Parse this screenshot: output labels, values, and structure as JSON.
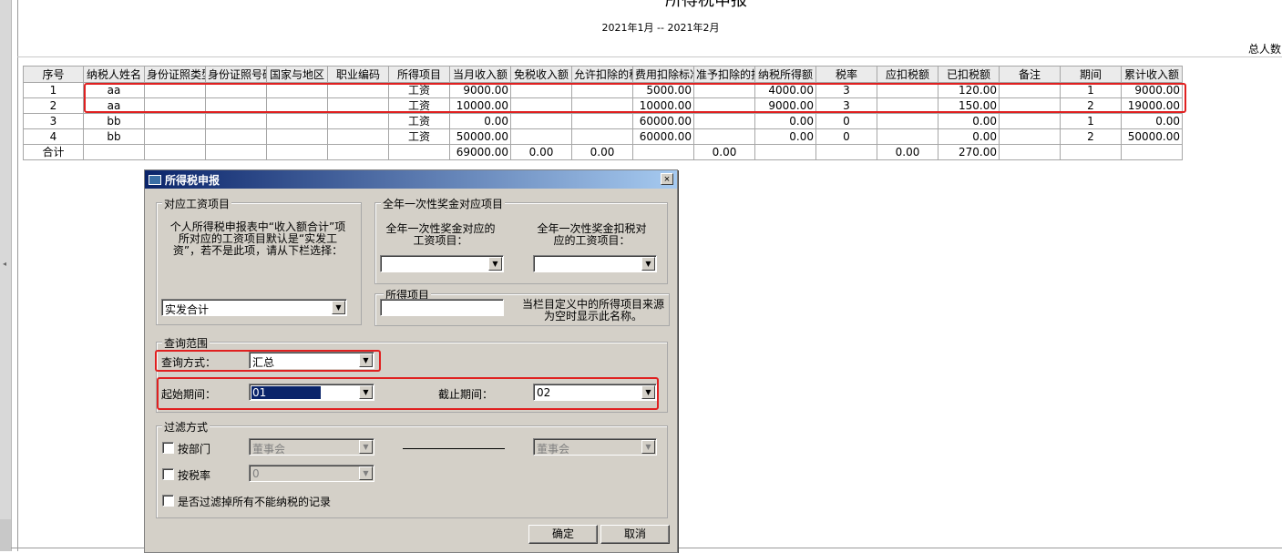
{
  "report": {
    "title": "所得税申报",
    "period": "2021年1月 -- 2021年2月",
    "total_people_label": "总人数"
  },
  "table": {
    "headers": [
      "序号",
      "纳税人姓名",
      "身份证照类型",
      "身份证照号码",
      "国家与地区",
      "职业编码",
      "所得项目",
      "当月收入额",
      "免税收入额",
      "允许扣除的税费",
      "费用扣除标准",
      "准予扣除的捐赠额",
      "纳税所得额",
      "税率",
      "应扣税额",
      "已扣税额",
      "备注",
      "期间",
      "累计收入额"
    ],
    "rows": [
      [
        "1",
        "aa",
        "",
        "",
        "",
        "",
        "工资",
        "9000.00",
        "",
        "",
        "5000.00",
        "",
        "4000.00",
        "3",
        "",
        "120.00",
        "",
        "1",
        "9000.00"
      ],
      [
        "2",
        "aa",
        "",
        "",
        "",
        "",
        "工资",
        "10000.00",
        "",
        "",
        "10000.00",
        "",
        "9000.00",
        "3",
        "",
        "150.00",
        "",
        "2",
        "19000.00"
      ],
      [
        "3",
        "bb",
        "",
        "",
        "",
        "",
        "工资",
        "0.00",
        "",
        "",
        "60000.00",
        "",
        "0.00",
        "0",
        "",
        "0.00",
        "",
        "1",
        "0.00"
      ],
      [
        "4",
        "bb",
        "",
        "",
        "",
        "",
        "工资",
        "50000.00",
        "",
        "",
        "60000.00",
        "",
        "0.00",
        "0",
        "",
        "0.00",
        "",
        "2",
        "50000.00"
      ]
    ],
    "total_row": [
      "合计",
      "",
      "",
      "",
      "",
      "",
      "",
      "69000.00",
      "0.00",
      "0.00",
      "",
      "0.00",
      "",
      "",
      "0.00",
      "270.00",
      "",
      "",
      ""
    ]
  },
  "dialog": {
    "title": "所得税申报",
    "close_glyph": "×",
    "salary_group": {
      "label": "对应工资项目",
      "description": "个人所得税申报表中“收入额合计”项所对应的工资项目默认是“实发工资”，若不是此项，请从下栏选择：",
      "selected": "实发合计"
    },
    "bonus_group": {
      "label": "全年一次性奖金对应项目",
      "income_label": "全年一次性奖金对应的工资项目：",
      "tax_label": "全年一次性奖金扣税对应的工资项目：",
      "income_value": "",
      "tax_value": ""
    },
    "income_item": {
      "label": "所得项目",
      "value": "",
      "note": "当栏目定义中的所得项目来源为空时显示此名称。"
    },
    "query_group": {
      "label": "查询范围",
      "method_label": "查询方式：",
      "method_value": "汇总",
      "start_label": "起始期间：",
      "start_value": "01",
      "end_label": "截止期间：",
      "end_value": "02"
    },
    "filter_group": {
      "label": "过滤方式",
      "by_dept_label": "按部门",
      "dept_from": "董事会",
      "dept_to": "董事会",
      "by_rate_label": "按税率",
      "rate_value": "0",
      "filter_nontax_label": "是否过滤掉所有不能纳税的记录"
    },
    "buttons": {
      "ok": "确定",
      "cancel": "取消"
    }
  },
  "colors": {
    "highlight": "#e02020",
    "dialog_bg": "#d4d0c8",
    "title_start": "#0a246a",
    "title_end": "#a6caf0"
  }
}
